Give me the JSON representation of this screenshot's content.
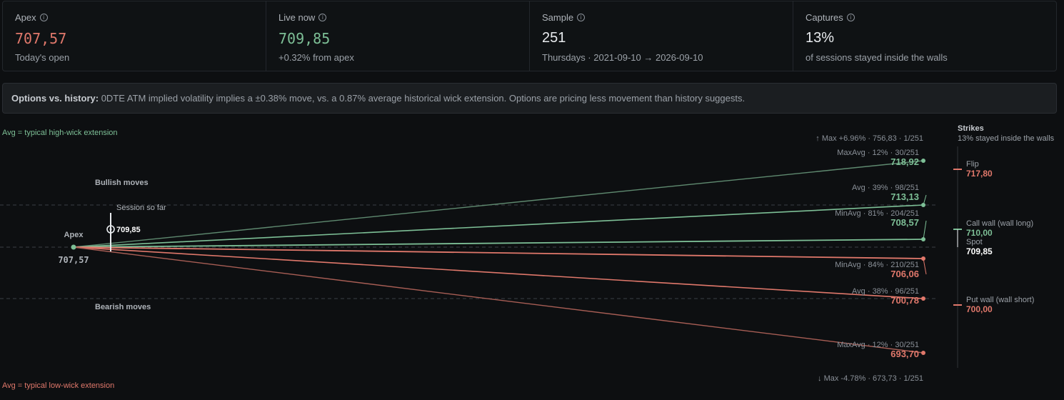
{
  "stats": [
    {
      "label": "Apex",
      "value": "707,57",
      "value_color": "#e0786b",
      "sub": "Today's open"
    },
    {
      "label": "Live now",
      "value": "709,85",
      "value_color": "#7dbf96",
      "sub": "+0.32% from apex"
    },
    {
      "label": "Sample",
      "value": "251",
      "value_color": "#e8ebee",
      "sub": "Thursdays · 2021-09-10 → 2026-09-10"
    },
    {
      "label": "Captures",
      "value": "13%",
      "value_color": "#e8ebee",
      "sub": "of sessions stayed inside the walls"
    }
  ],
  "banner": {
    "title": "Options vs. history:",
    "text": " 0DTE ATM implied volatility implies a ±0.38% move, vs. a 0.87% average historical wick extension. Options are pricing less movement than history suggests."
  },
  "legend": {
    "top": "Avg = typical high-wick extension",
    "bottom": "Avg = typical low-wick extension"
  },
  "labels": {
    "bullish": "Bullish moves",
    "bearish": "Bearish moves",
    "apex": "Apex",
    "apex_value": "707,57",
    "session": "Session so far",
    "session_value": "709,85"
  },
  "max_up": "↑ Max +6.96% · 756,83 · 1/251",
  "max_down": "↓ Max -4.78% · 673,73 · 1/251",
  "projections": [
    {
      "name": "MaxAvg · 12% · 30/251",
      "value": "718,92",
      "dir": "up"
    },
    {
      "name": "Avg · 39% · 98/251",
      "value": "713,13",
      "dir": "up"
    },
    {
      "name": "MinAvg · 81% · 204/251",
      "value": "708,57",
      "dir": "up"
    },
    {
      "name": "MinAvg · 84% · 210/251",
      "value": "706,06",
      "dir": "down"
    },
    {
      "name": "Avg · 38% · 96/251",
      "value": "700,78",
      "dir": "down"
    },
    {
      "name": "MaxAvg · 12% · 30/251",
      "value": "693,70",
      "dir": "down"
    }
  ],
  "strikes": {
    "title": "Strikes",
    "subtitle": "13% stayed inside the walls",
    "items": [
      {
        "name": "Flip",
        "value": "717,80",
        "color": "#e0786b"
      },
      {
        "name": "Call wall (wall long)",
        "value": "710,00",
        "color": "#7dbf96"
      },
      {
        "name": "Spot",
        "value": "709,85",
        "color": "#ffffff"
      },
      {
        "name": "Put wall (wall short)",
        "value": "700,00",
        "color": "#e0786b"
      }
    ]
  },
  "colors": {
    "green": "#7dbf96",
    "red": "#e0786b",
    "muted": "#8a9098"
  }
}
